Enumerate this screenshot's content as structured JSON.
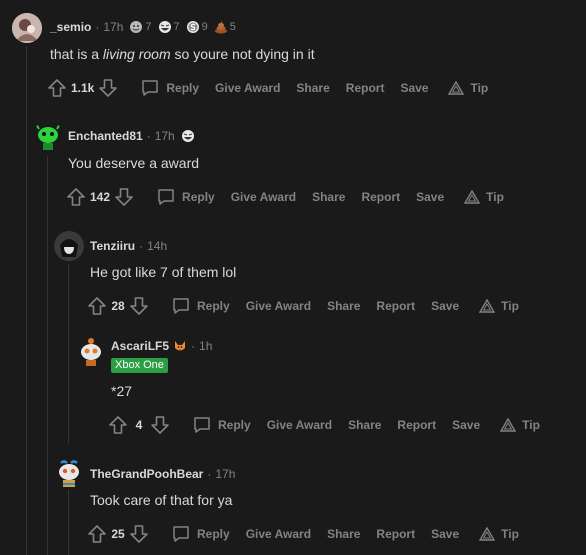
{
  "labels": {
    "reply": "Reply",
    "give_award": "Give Award",
    "share": "Share",
    "report": "Report",
    "save": "Save",
    "tip": "Tip"
  },
  "separator": "·",
  "colors": {
    "background": "#1a1a1b",
    "text": "#d7dadc",
    "muted": "#818384",
    "thread_line": "#343536",
    "flair_bg": "#2e9e44"
  },
  "comments": [
    {
      "username": "_semio",
      "time": "17h",
      "awards": [
        {
          "icon": "wholesome-seal-icon",
          "count": "7"
        },
        {
          "icon": "laughing-face-icon",
          "count": "7"
        },
        {
          "icon": "silver-coin-icon",
          "count": "9"
        },
        {
          "icon": "poop-icon",
          "count": "5"
        }
      ],
      "body_prefix": "that is a ",
      "body_emphasis": "living room",
      "body_suffix": " so youre not dying in it",
      "score": "1.1k"
    },
    {
      "username": "Enchanted81",
      "time": "17h",
      "awards": [
        {
          "icon": "laughing-face-icon"
        }
      ],
      "body": "You deserve a award",
      "score": "142"
    },
    {
      "username": "Tenziiru",
      "time": "14h",
      "body": "He got like 7 of them lol",
      "score": "28"
    },
    {
      "username": "AscariLF5",
      "time": "1h",
      "flair": "Xbox One",
      "user_badge": "fox-emoji-icon",
      "body": "*27",
      "score": "4"
    },
    {
      "username": "TheGrandPoohBear",
      "time": "17h",
      "body": "Took care of that for ya",
      "score": "25"
    }
  ]
}
